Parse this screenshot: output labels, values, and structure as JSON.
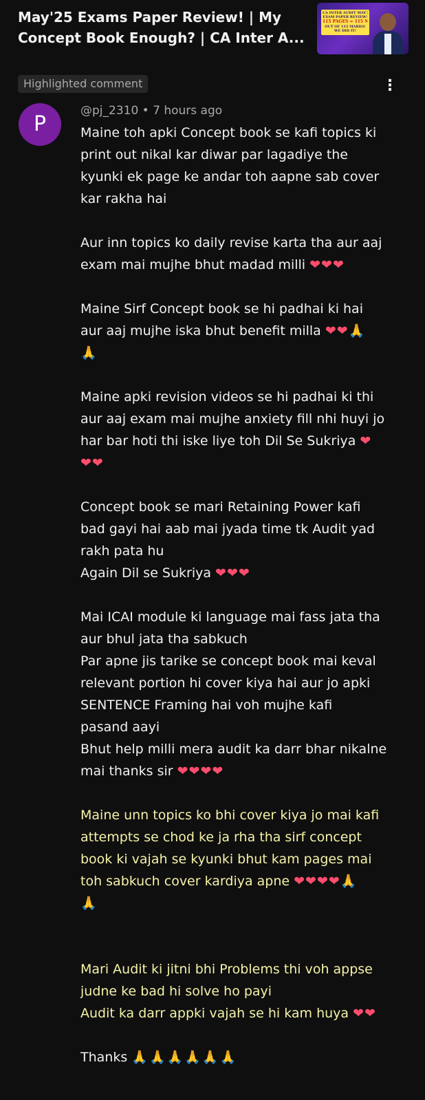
{
  "video": {
    "title_line1": "May'25 Exams Paper Review! | My",
    "title_line2": "Concept Book Enough? | CA Inter A...",
    "thumbnail": {
      "line1": "CA INTER AUDIT MAY'25",
      "line2": "EXAM PAPER REVIEW!",
      "line3": "115 PAGES = 115 MARKS",
      "line4": "OUT OF 115 MARKS!",
      "line5": "WE DID IT!"
    }
  },
  "comment": {
    "badge": "Highlighted comment",
    "more_icon": "⋮",
    "avatar_letter": "P",
    "author": "@pj_2310",
    "separator": " • ",
    "time": "7 hours ago",
    "p1": {
      "l1": "Maine toh apki Concept book se kafi topics ki",
      "l2": "print out nikal kar diwar par lagadiye the",
      "l3": "kyunki ek page ke andar toh aapne sab cover",
      "l4": "kar rakha hai"
    },
    "p2": {
      "l1": "Aur inn topics ko daily revise karta tha aur aaj",
      "l2": "exam mai mujhe bhut madad milli",
      "l2_emoji": "❤❤❤"
    },
    "p3": {
      "l1": "Maine Sirf Concept book se hi padhai ki hai",
      "l2": "aur aaj mujhe iska bhut benefit milla",
      "l2_emoji": "❤❤",
      "l2_pray": "🙏",
      "l3_pray": "🙏"
    },
    "p4": {
      "l1": "Maine apki revision videos se hi padhai ki thi",
      "l2": "aur aaj exam mai mujhe anxiety fill nhi huyi jo",
      "l3": "har bar hoti thi iske liye toh Dil Se Sukriya",
      "l3_emoji": "❤",
      "l4_emoji": "❤❤"
    },
    "p5": {
      "l1": "Concept book se mari Retaining Power kafi",
      "l2": "bad gayi hai aab mai jyada  time tk Audit yad",
      "l3": "rakh pata hu",
      "l4": "Again Dil se Sukriya",
      "l4_emoji": "❤❤❤"
    },
    "p6": {
      "l1": "Mai ICAI module ki language mai fass jata tha",
      "l2": "aur bhul jata tha sabkuch",
      "l3": "Par apne jis tarike se concept book mai keval",
      "l4": "relevant portion hi cover kiya hai aur jo apki",
      "l5": "SENTENCE Framing hai voh mujhe kafi",
      "l6": "pasand aayi",
      "l7": "Bhut help milli mera audit ka darr bhar nikalne",
      "l8": "mai thanks sir",
      "l8_emoji": "❤❤❤❤"
    },
    "p7": {
      "l1": "Maine unn topics ko bhi cover kiya jo mai kafi",
      "l2": "attempts se chod ke ja rha tha sirf concept",
      "l3": "book ki vajah se kyunki bhut kam pages mai",
      "l4": "toh sabkuch cover kardiya apne",
      "l4_emoji": "❤❤❤❤",
      "l4_pray": "🙏",
      "l5_pray": "🙏"
    },
    "p8": {
      "l1": "Mari Audit ki jitni bhi Problems thi voh appse",
      "l2": "judne ke bad hi solve ho payi",
      "l3": "Audit ka darr appki vajah se hi kam huya",
      "l3_emoji": "❤❤"
    },
    "p9": {
      "l1": "Thanks",
      "l1_pray": "🙏🙏🙏🙏🙏🙏"
    }
  }
}
